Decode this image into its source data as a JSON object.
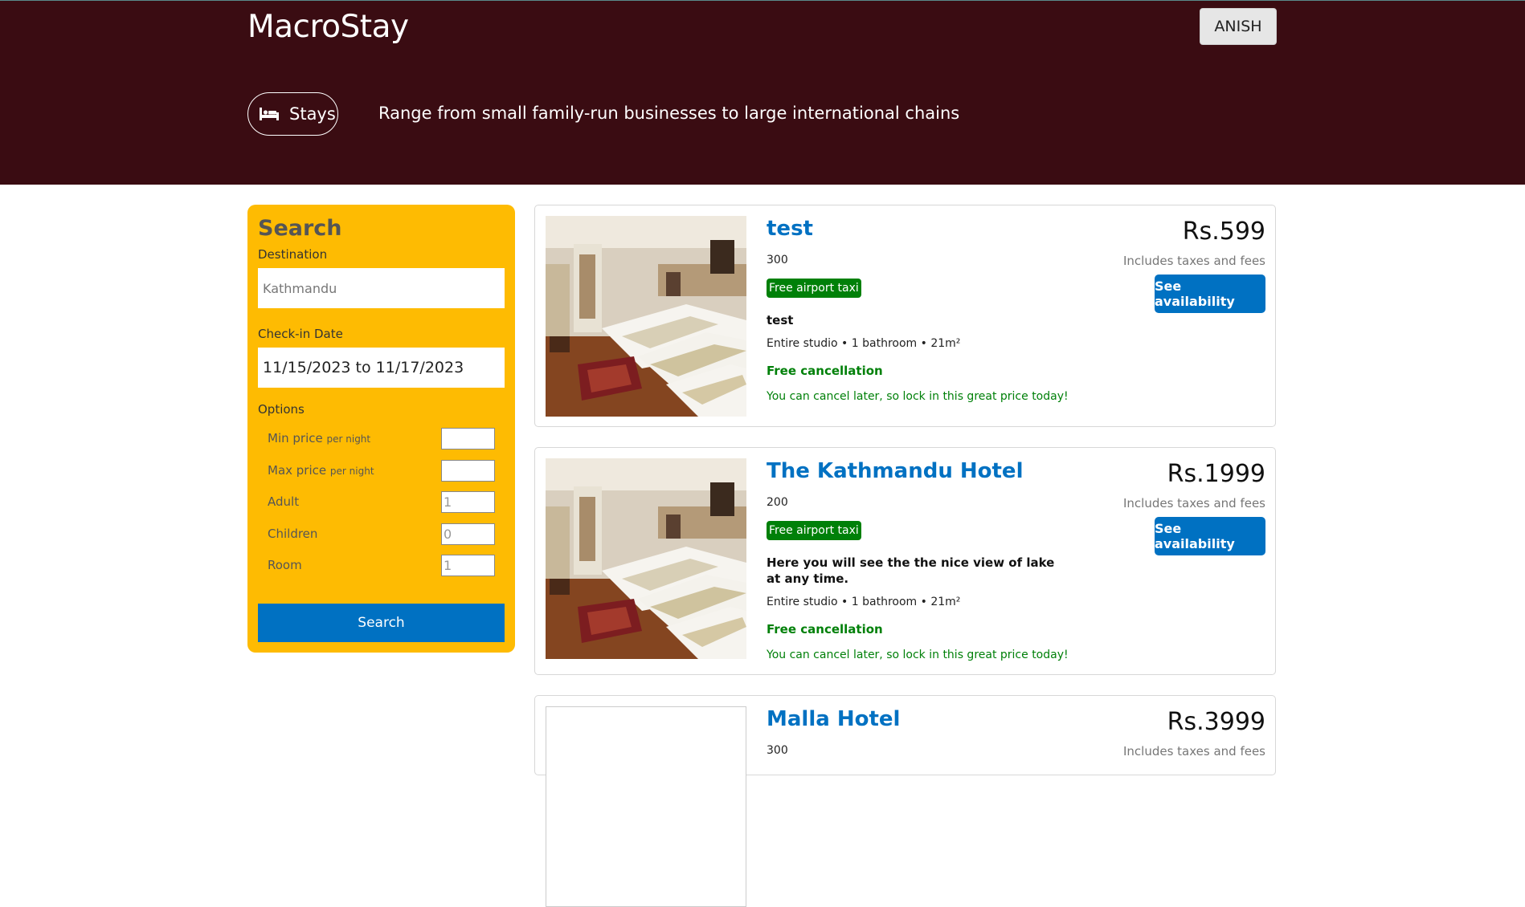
{
  "header": {
    "brand": "MacroStay",
    "user_button": "ANISH",
    "stays_label": "Stays",
    "tagline": "Range from small family-run businesses to large international chains"
  },
  "search": {
    "title": "Search",
    "destination_label": "Destination",
    "destination_placeholder": "Kathmandu",
    "checkin_label": "Check-in Date",
    "checkin_value": "11/15/2023 to 11/17/2023",
    "options_label": "Options",
    "options": [
      {
        "label": "Min price",
        "suffix": "per night",
        "value": ""
      },
      {
        "label": "Max price",
        "suffix": "per night",
        "value": ""
      },
      {
        "label": "Adult",
        "suffix": "",
        "value": "1"
      },
      {
        "label": "Children",
        "suffix": "",
        "value": "0"
      },
      {
        "label": "Room",
        "suffix": "",
        "value": "1"
      }
    ],
    "button": "Search"
  },
  "results": [
    {
      "title": "test",
      "distance": "300",
      "taxi": "Free airport taxi",
      "subtitle": "test",
      "features": "Entire studio • 1 bathroom • 21m²",
      "cancel": "Free cancellation",
      "cancel_sub": "You can cancel later, so lock in this great price today!",
      "price": "Rs.599",
      "taxes": "Includes taxes and fees",
      "button": "See availability"
    },
    {
      "title": "The Kathmandu Hotel",
      "distance": "200",
      "taxi": "Free airport taxi",
      "subtitle": "Here you will see the the nice view of lake at any time.",
      "features": "Entire studio • 1 bathroom • 21m²",
      "cancel": "Free cancellation",
      "cancel_sub": "You can cancel later, so lock in this great price today!",
      "price": "Rs.1999",
      "taxes": "Includes taxes and fees",
      "button": "See availability"
    },
    {
      "title": "Malla Hotel",
      "distance": "300",
      "price": "Rs.3999",
      "taxes": "Includes taxes and fees"
    }
  ]
}
